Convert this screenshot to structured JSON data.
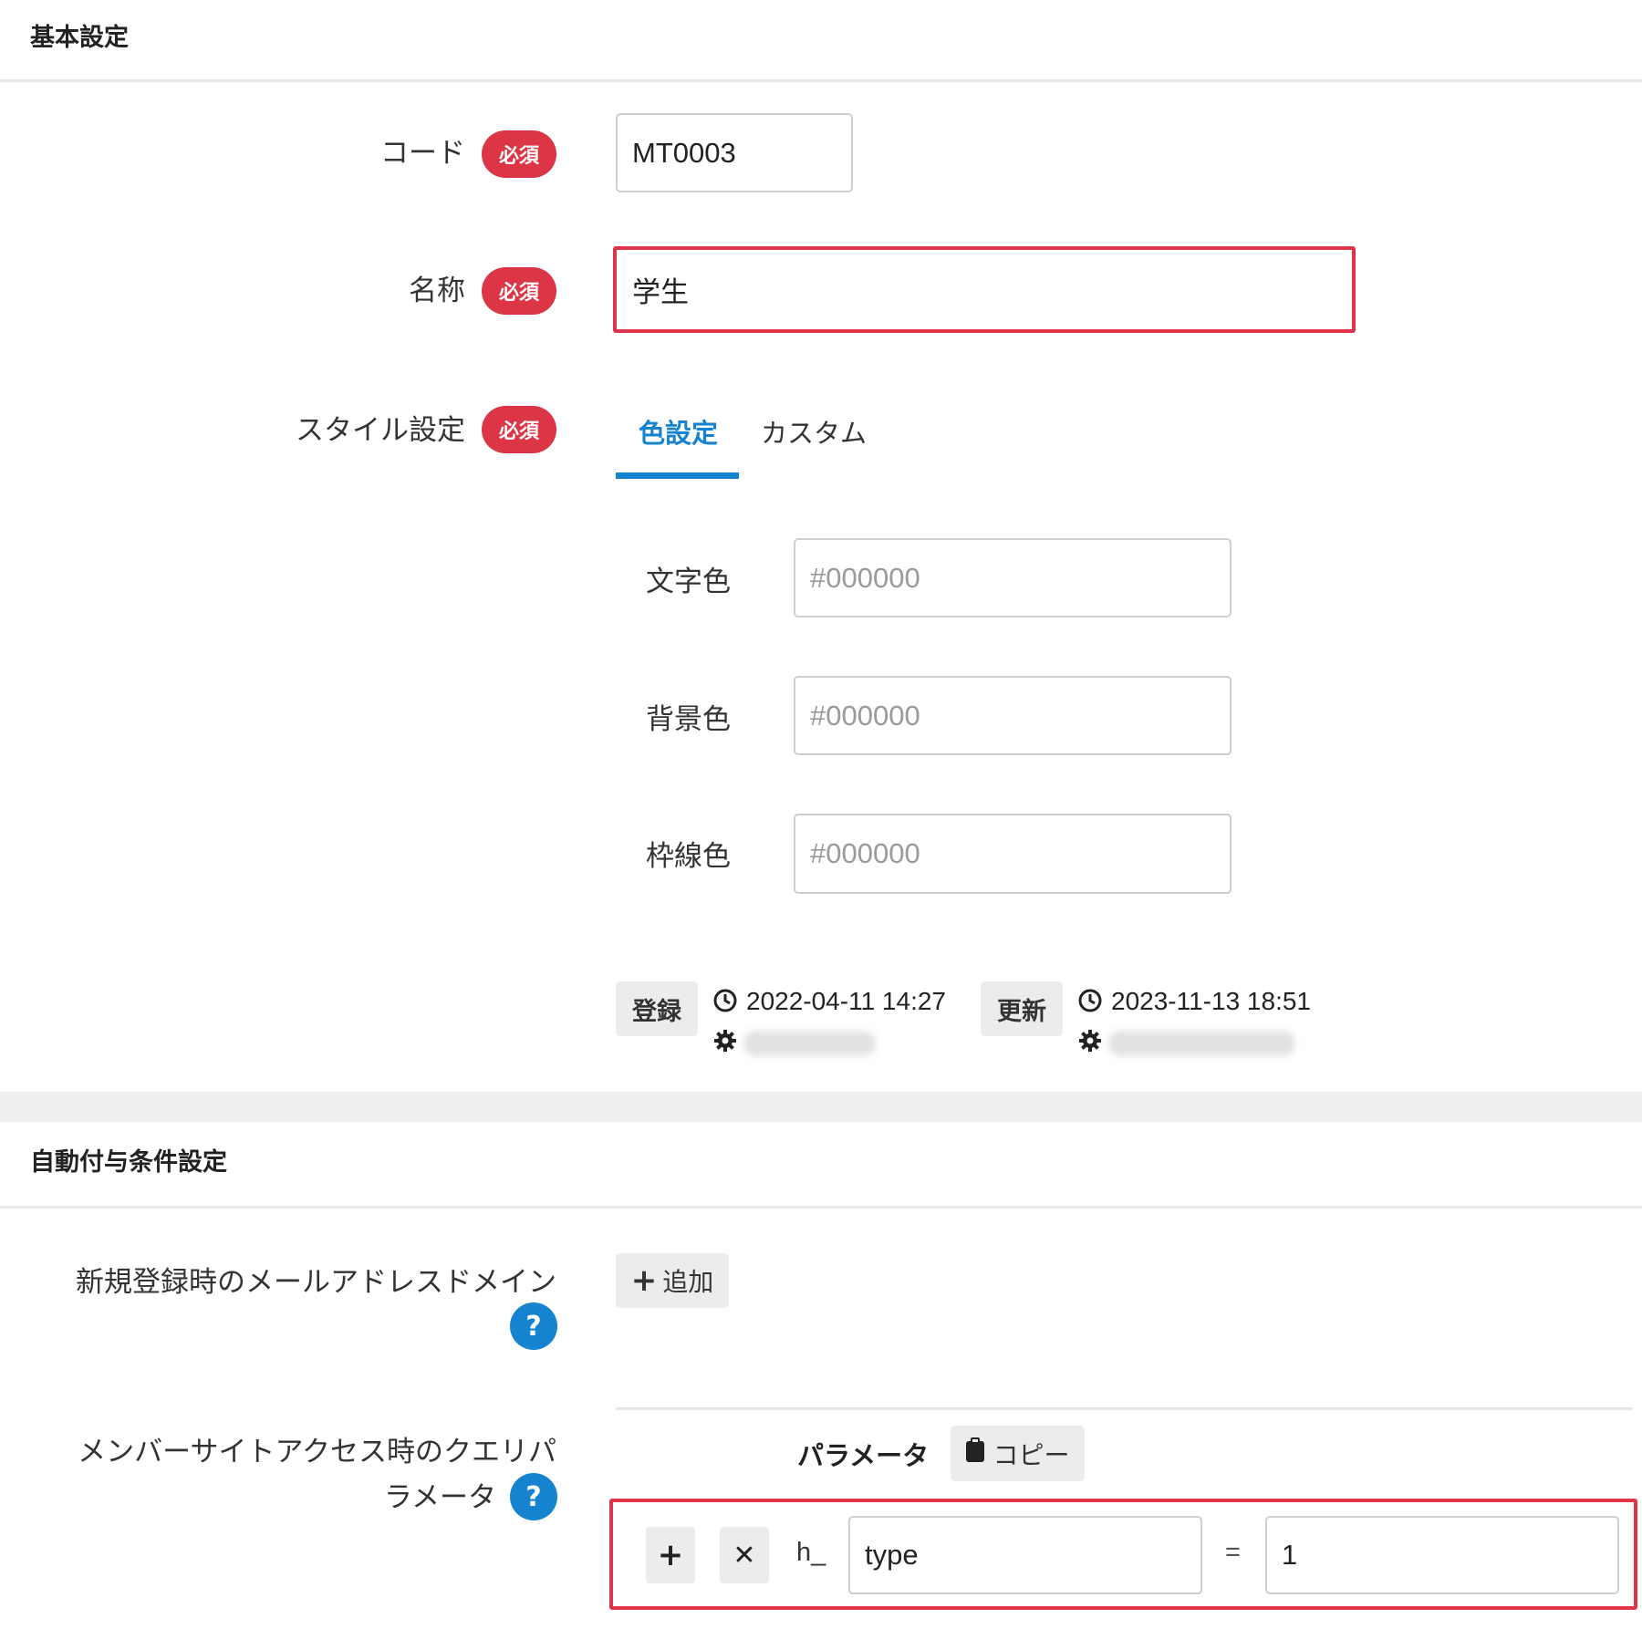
{
  "basic": {
    "heading": "基本設定",
    "code": {
      "label": "コード",
      "required": "必須",
      "value": "MT0003"
    },
    "name": {
      "label": "名称",
      "required": "必須",
      "value": "学生"
    },
    "style": {
      "label": "スタイル設定",
      "required": "必須",
      "tabs": [
        {
          "label": "色設定",
          "active": true
        },
        {
          "label": "カスタム",
          "active": false
        }
      ],
      "fields": [
        {
          "label": "文字色",
          "placeholder": "#000000"
        },
        {
          "label": "背景色",
          "placeholder": "#000000"
        },
        {
          "label": "枠線色",
          "placeholder": "#000000"
        }
      ]
    },
    "meta": {
      "created_label": "登録",
      "created_time": "2022-04-11 14:27",
      "updated_label": "更新",
      "updated_time": "2023-11-13 18:51"
    }
  },
  "auto": {
    "heading": "自動付与条件設定",
    "email_domain": {
      "label": "新規登録時のメールアドレスドメイン",
      "add_label": "追加",
      "help": "?"
    },
    "query": {
      "label_line1": "メンバーサイトアクセス時のクエリパ",
      "label_line2": "ラメータ",
      "help": "?",
      "param_header": "パラメータ",
      "copy_label": "コピー",
      "prefix": "h_",
      "key": "type",
      "equals": "=",
      "value": "1"
    }
  },
  "colors": {
    "accent": "#1683d1",
    "required": "#dc3545",
    "highlight": "#e0344a"
  }
}
